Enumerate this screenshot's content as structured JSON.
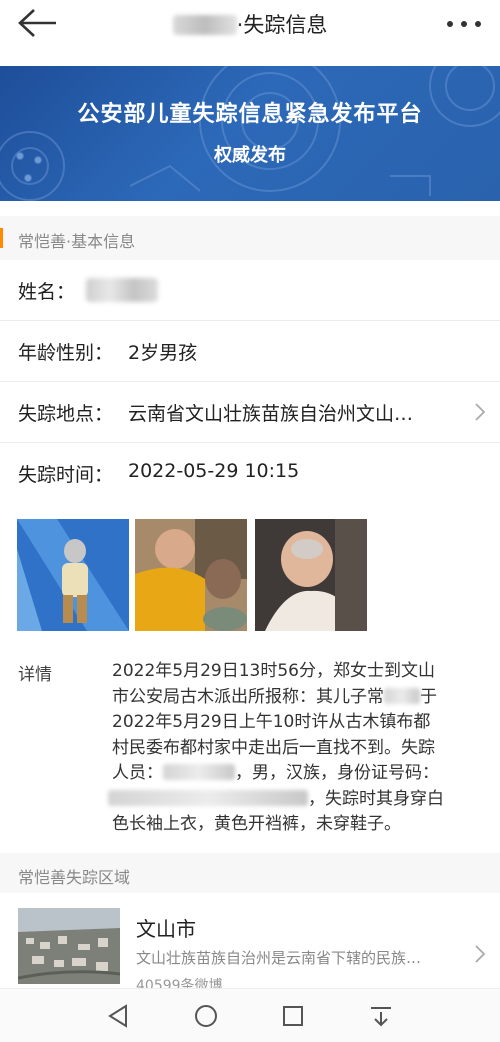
{
  "header": {
    "title_suffix": "·失踪信息",
    "back_icon": "arrow-left-icon",
    "more_icon": "more-dots-icon"
  },
  "banner": {
    "title": "公安部儿童失踪信息紧急发布平台",
    "subtitle": "权威发布",
    "color": "#2a62ad"
  },
  "basic_section": {
    "title": "常恺善·基本信息",
    "accent_color": "#ff8a00"
  },
  "fields": {
    "name_label": "姓名：",
    "age_label": "年龄性别：",
    "age_value": "2岁男孩",
    "location_label": "失踪地点：",
    "location_value": "云南省文山壮族苗族自治州文山…",
    "time_label": "失踪时间：",
    "time_value": "2022-05-29 10:15"
  },
  "details": {
    "label": "详情",
    "line1": "2022年5月29日13时56分，郑女士到文山",
    "line2a": "市公安局古木派出所报称：其儿子常",
    "line2b": "于",
    "line3": "2022年5月29日上午10时许从古木镇布都",
    "line4": "村民委布都村家中走出后一直找不到。失踪",
    "line5a": "人员：",
    "line5b": "，男，汉族，身份证号码：",
    "line6b": "，失踪时其身穿白",
    "line7": "色长袖上衣，黄色开裆裤，未穿鞋子。"
  },
  "area_section": {
    "title": "常恺善失踪区域",
    "city": "文山市",
    "desc": "文山壮族苗族自治州是云南省下辖的民族…",
    "count": "40599条微博"
  },
  "navbar": {
    "back_icon": "triangle-back-icon",
    "home_icon": "circle-home-icon",
    "recent_icon": "square-recent-icon",
    "menu_icon": "menu-down-icon"
  }
}
